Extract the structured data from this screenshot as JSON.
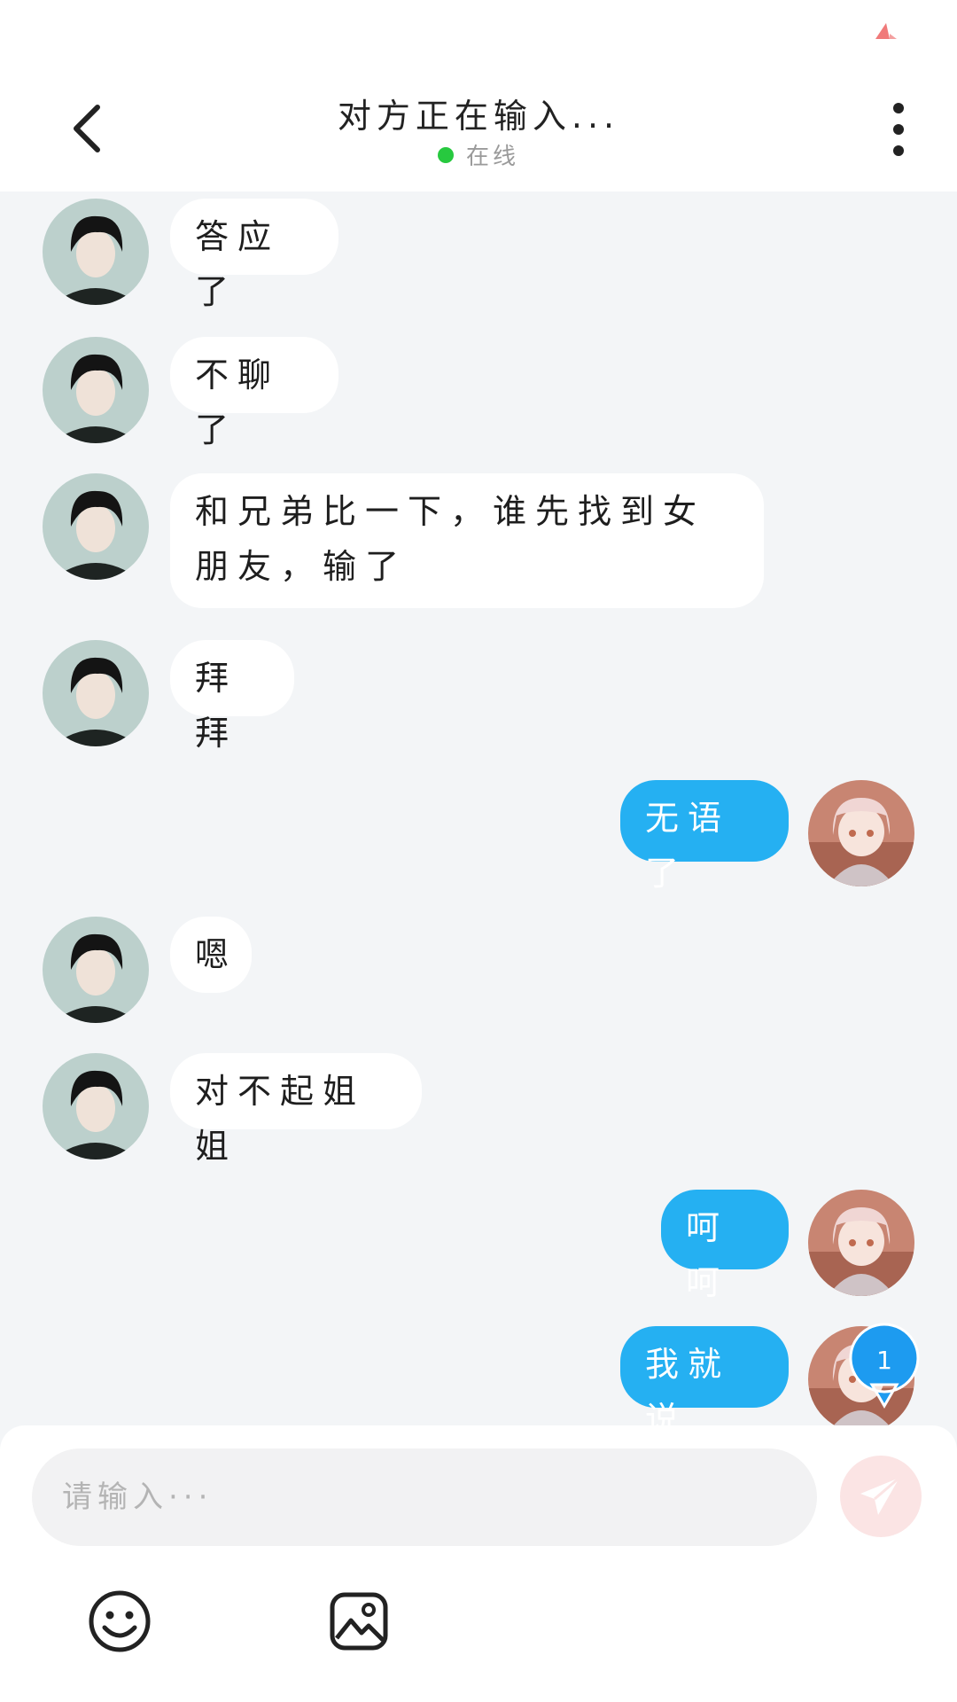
{
  "header": {
    "title": "对方正在输入...",
    "status": "在线",
    "status_color": "#27c93f"
  },
  "colors": {
    "incoming_bubble": "#ffffff",
    "outgoing_bubble": "#25b0f2",
    "background": "#f3f5f7"
  },
  "icons": {
    "back": "chevron-left-icon",
    "more": "more-vertical-icon",
    "send": "paper-plane-icon",
    "emoji": "smile-face-icon",
    "image": "image-icon"
  },
  "messages": [
    {
      "side": "in",
      "text": "答应了"
    },
    {
      "side": "in",
      "text": "不聊了"
    },
    {
      "side": "in",
      "text": "和兄弟比一下，谁先找到女朋友，输了"
    },
    {
      "side": "in",
      "text": "拜拜"
    },
    {
      "side": "out",
      "text": "无语了"
    },
    {
      "side": "in",
      "text": "嗯"
    },
    {
      "side": "in",
      "text": "对不起姐姐"
    },
    {
      "side": "out",
      "text": "呵呵"
    },
    {
      "side": "out",
      "text": "我就说"
    }
  ],
  "badge": {
    "count": "1"
  },
  "input": {
    "placeholder": "请输入···"
  }
}
